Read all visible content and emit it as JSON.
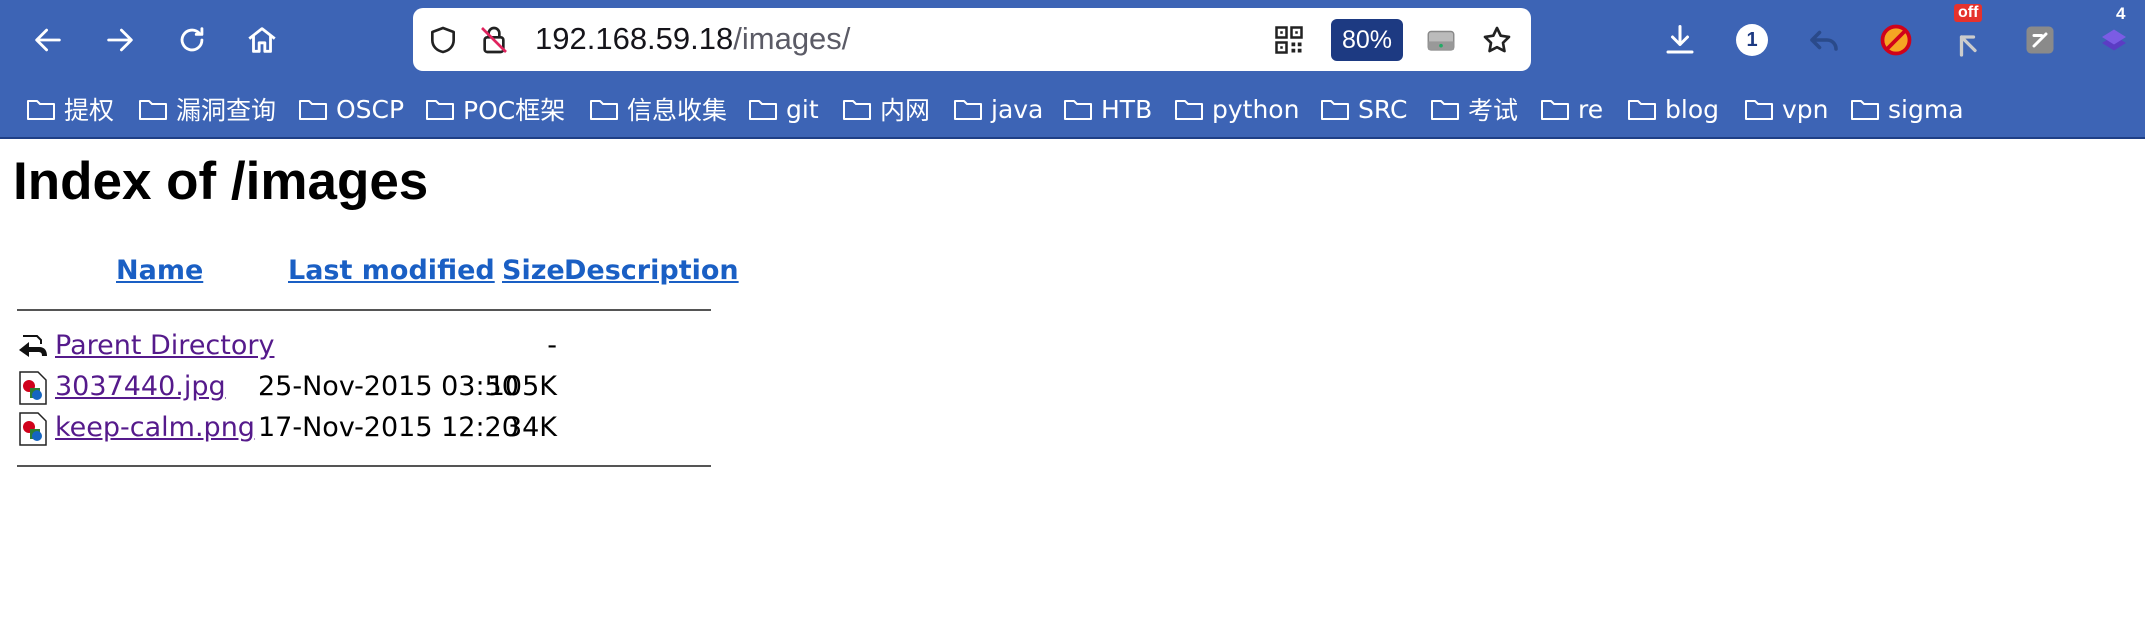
{
  "browser": {
    "url_host": "192.168.59.18",
    "url_path": "/images/",
    "zoom": "80%",
    "badge_count": "1",
    "ext_off_label": "off",
    "ext_count": "4",
    "accent_color": "#3d64b5",
    "icons": [
      "back-icon",
      "forward-icon",
      "reload-icon",
      "home-icon",
      "shield-icon",
      "insecure-lock-icon",
      "qr-code-icon",
      "storage-icon",
      "star-icon",
      "download-icon",
      "undo-icon",
      "no-script-icon",
      "ext-off-icon",
      "ext-note-icon",
      "ext-purple-icon"
    ]
  },
  "bookmarks": [
    {
      "label": "提权"
    },
    {
      "label": "漏洞查询"
    },
    {
      "label": "OSCP"
    },
    {
      "label": "POC框架"
    },
    {
      "label": "信息收集"
    },
    {
      "label": "git"
    },
    {
      "label": "内网"
    },
    {
      "label": "java"
    },
    {
      "label": "HTB"
    },
    {
      "label": "python"
    },
    {
      "label": "SRC"
    },
    {
      "label": "考试"
    },
    {
      "label": "re"
    },
    {
      "label": "blog"
    },
    {
      "label": "vpn"
    },
    {
      "label": "sigma"
    }
  ],
  "page": {
    "title": "Index of /images",
    "columns": {
      "name": "Name",
      "modified": "Last modified",
      "size": "Size",
      "description": "Description"
    },
    "rows": [
      {
        "name": "Parent Directory",
        "modified": "",
        "size": "-",
        "icon": "back-folder-icon"
      },
      {
        "name": "3037440.jpg",
        "modified": "25-Nov-2015 03:50",
        "size": "105K",
        "icon": "image-file-icon"
      },
      {
        "name": "keep-calm.png",
        "modified": "17-Nov-2015 12:20",
        "size": "34K",
        "icon": "image-file-icon"
      }
    ]
  }
}
